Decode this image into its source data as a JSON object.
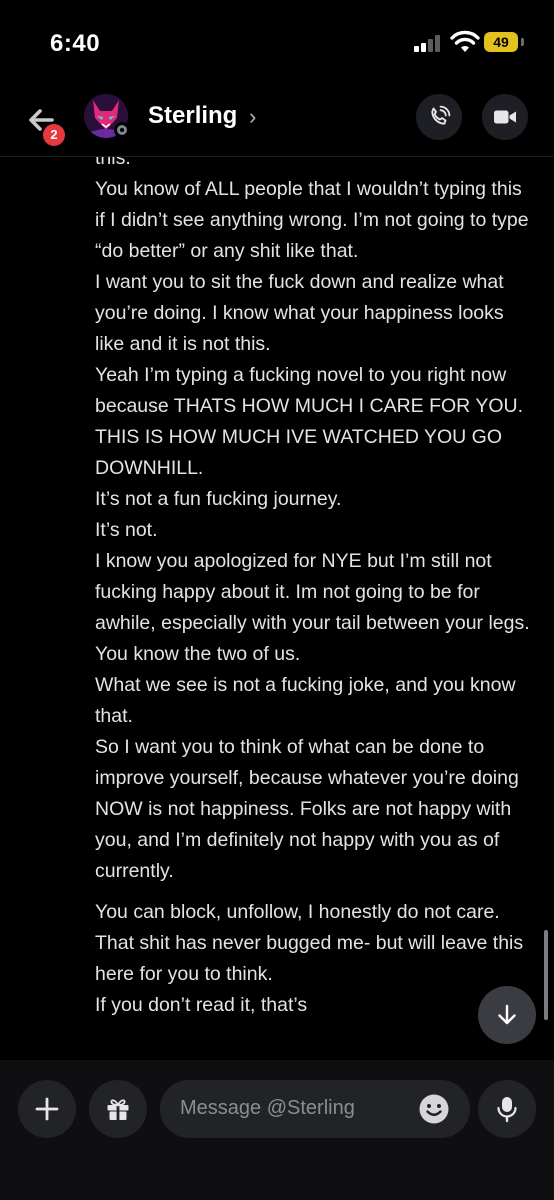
{
  "status_bar": {
    "time": "6:40",
    "battery": "49"
  },
  "header": {
    "name": "Sterling",
    "chevron": "›",
    "unread_count": "2"
  },
  "messages": [
    "this.",
    "You know of ALL people that I wouldn’t typing this if I didn’t see anything wrong. I’m not going to type “do better” or any shit like that.",
    "I want you to sit the fuck down and realize what you’re doing. I know what your happiness looks like and it is not this.",
    "Yeah I’m typing a fucking novel to you right now because THATS HOW MUCH I CARE FOR YOU. THIS IS HOW MUCH IVE WATCHED YOU GO DOWNHILL.",
    "It’s not a fun fucking journey.",
    "It’s not.",
    "I know you apologized for NYE but I’m still not fucking happy about it. Im not going to be for awhile, especially with your tail between your legs.",
    "You know the two of us.",
    "What we see is not a fucking joke, and you know that.",
    "So I want you to think of what can be done to improve yourself, because whatever you’re doing NOW is not happiness. Folks are not happy with you, and I’m definitely not happy with you as of currently.",
    "You can block, unfollow, I honestly do not care. That shit has never bugged me- but will leave this here for you to think.",
    "If you don’t read it, that’s"
  ],
  "composer": {
    "placeholder": "Message @Sterling"
  },
  "colors": {
    "background": "#000000",
    "badge": "#e5393d",
    "battery": "#e3c21f",
    "button": "#222327"
  },
  "icons": [
    "back-arrow-icon",
    "phone-call-icon",
    "video-camera-icon",
    "plus-icon",
    "gift-icon",
    "emoji-icon",
    "microphone-icon",
    "arrow-down-icon"
  ]
}
